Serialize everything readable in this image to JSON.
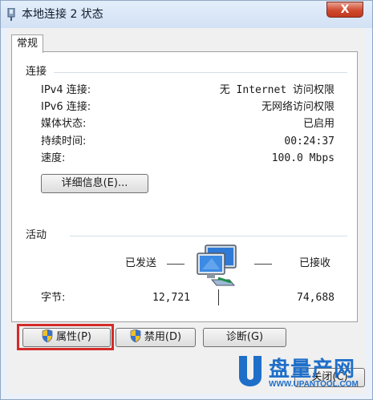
{
  "window": {
    "title": "本地连接 2 状态",
    "close_glyph": "X"
  },
  "tabs": [
    {
      "label": "常规"
    }
  ],
  "connection": {
    "group_label": "连接",
    "rows": [
      {
        "label": "IPv4 连接:",
        "value": "无 Internet 访问权限"
      },
      {
        "label": "IPv6 连接:",
        "value": "无网络访问权限"
      },
      {
        "label": "媒体状态:",
        "value": "已启用"
      },
      {
        "label": "持续时间:",
        "value": "00:24:37"
      },
      {
        "label": "速度:",
        "value": "100.0 Mbps"
      }
    ],
    "details_button": "详细信息(E)..."
  },
  "activity": {
    "group_label": "活动",
    "sent_label": "已发送",
    "received_label": "已接收",
    "bytes_label": "字节:",
    "bytes_sent": "12,721",
    "bytes_received": "74,688"
  },
  "buttons": {
    "properties": "属性(P)",
    "disable": "禁用(D)",
    "diagnose": "诊断(G)",
    "close": "关闭(C)"
  },
  "watermark": {
    "title": "盘量产网",
    "url": "WWW.UPANTOOL.COM"
  },
  "colors": {
    "highlight": "#d42a2a",
    "watermark": "#1f6fc9"
  }
}
